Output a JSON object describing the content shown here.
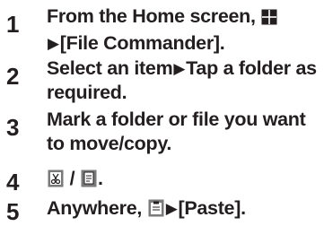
{
  "steps": [
    {
      "number": "1",
      "parts": [
        {
          "t": "text",
          "v": "From the Home screen, "
        },
        {
          "t": "icon",
          "name": "apps-grid-icon"
        },
        {
          "t": "arrow",
          "v": "▶"
        },
        {
          "t": "text",
          "v": "[File Commander]."
        }
      ]
    },
    {
      "number": "2",
      "parts": [
        {
          "t": "text",
          "v": "Select an item"
        },
        {
          "t": "arrow",
          "v": "▶"
        },
        {
          "t": "text",
          "v": "Tap a folder as required."
        }
      ]
    },
    {
      "number": "3",
      "parts": [
        {
          "t": "text",
          "v": "Mark a folder or file you want to move/copy."
        }
      ]
    },
    {
      "number": "4",
      "parts": [
        {
          "t": "icon",
          "name": "cut-icon"
        },
        {
          "t": "text",
          "v": " / "
        },
        {
          "t": "icon",
          "name": "copy-icon"
        },
        {
          "t": "text",
          "v": "."
        }
      ]
    },
    {
      "number": "5",
      "parts": [
        {
          "t": "text",
          "v": "Anywhere, "
        },
        {
          "t": "icon",
          "name": "paste-icon"
        },
        {
          "t": "arrow",
          "v": "▶"
        },
        {
          "t": "text",
          "v": "[Paste]."
        }
      ]
    }
  ]
}
